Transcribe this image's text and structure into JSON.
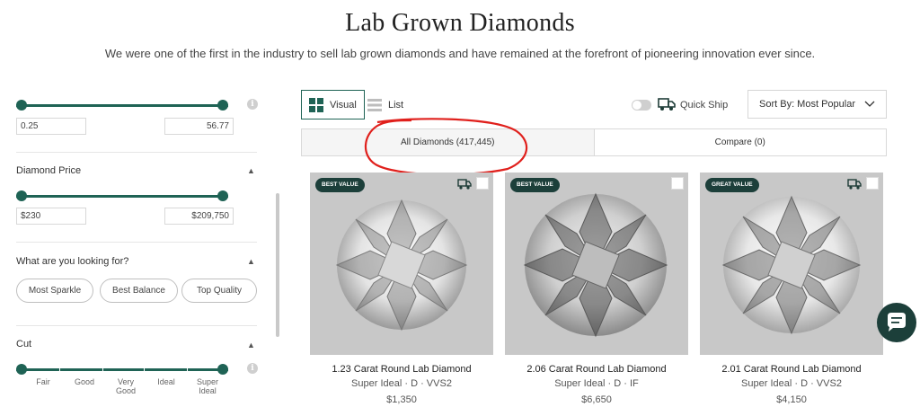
{
  "page": {
    "title": "Lab Grown Diamonds",
    "subtitle": "We were one of the first in the industry to sell lab grown diamonds and have remained at the forefront of pioneering innovation ever since."
  },
  "filters": {
    "carat": {
      "min": "0.25",
      "max": "56.77"
    },
    "price": {
      "title": "Diamond Price",
      "min": "$230",
      "max": "$209,750"
    },
    "looking_for": {
      "title": "What are you looking for?",
      "options": [
        "Most Sparkle",
        "Best Balance",
        "Top Quality"
      ]
    },
    "cut": {
      "title": "Cut",
      "grades": [
        "Fair",
        "Good",
        "Very\nGood",
        "Ideal",
        "Super\nIdeal"
      ]
    }
  },
  "toolbar": {
    "view_visual": "Visual",
    "view_list": "List",
    "quick_ship": "Quick Ship",
    "sort_label": "Sort By: Most Popular"
  },
  "tabs": {
    "all_diamonds": "All Diamonds (417,445)",
    "compare": "Compare (0)"
  },
  "products": [
    {
      "badge": "BEST VALUE",
      "name": "1.23 Carat Round Lab Diamond",
      "spec": "Super Ideal · D · VVS2",
      "price": "$1,350"
    },
    {
      "badge": "BEST VALUE",
      "name": "2.06 Carat Round Lab Diamond",
      "spec": "Super Ideal · D · IF",
      "price": "$6,650"
    },
    {
      "badge": "GREAT VALUE",
      "name": "2.01 Carat Round Lab Diamond",
      "spec": "Super Ideal · D · VVS2",
      "price": "$4,150"
    }
  ],
  "colors": {
    "brand": "#1f6355",
    "badge": "#1c3f3a",
    "annotation": "#e0201c"
  }
}
